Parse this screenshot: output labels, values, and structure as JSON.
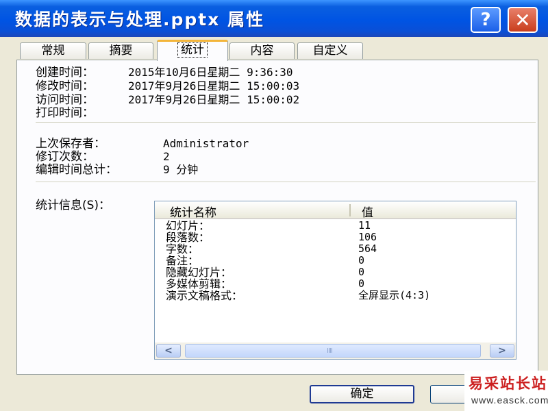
{
  "window": {
    "title": "数据的表示与处理.pptx 属性",
    "help_button": "?",
    "close_button": "✕"
  },
  "tabs": [
    {
      "label": "常规"
    },
    {
      "label": "摘要"
    },
    {
      "label": "统计",
      "active": true
    },
    {
      "label": "内容"
    },
    {
      "label": "自定义"
    }
  ],
  "times": {
    "created_label": "创建时间：",
    "created_value": "2015年10月6日星期二  9:36:30",
    "modified_label": "修改时间：",
    "modified_value": "2017年9月26日星期二  15:00:03",
    "accessed_label": "访问时间：",
    "accessed_value": "2017年9月26日星期二  15:00:02",
    "printed_label": "打印时间：",
    "printed_value": ""
  },
  "saving": {
    "last_saved_by_label": "上次保存者：",
    "last_saved_by_value": "Administrator",
    "revision_label": "修订次数：",
    "revision_value": "2",
    "edit_time_label": "编辑时间总计：",
    "edit_time_value": "9 分钟"
  },
  "statistics": {
    "label": "统计信息(S)：",
    "columns": {
      "name": "统计名称",
      "value": "值"
    },
    "rows": [
      {
        "name": "幻灯片：",
        "value": "11"
      },
      {
        "name": "段落数：",
        "value": "106"
      },
      {
        "name": "字数：",
        "value": "564"
      },
      {
        "name": "备注：",
        "value": "0"
      },
      {
        "name": "隐藏幻灯片：",
        "value": "0"
      },
      {
        "name": "多媒体剪辑：",
        "value": "0"
      },
      {
        "name": "演示文稿格式：",
        "value": "全屏显示(4:3)"
      }
    ],
    "scroll_left": "<",
    "scroll_right": ">",
    "scroll_grip": "IIII"
  },
  "buttons": {
    "ok": "确定"
  },
  "watermark": {
    "site_name": "易采站长站",
    "url": "www.easck.com"
  }
}
